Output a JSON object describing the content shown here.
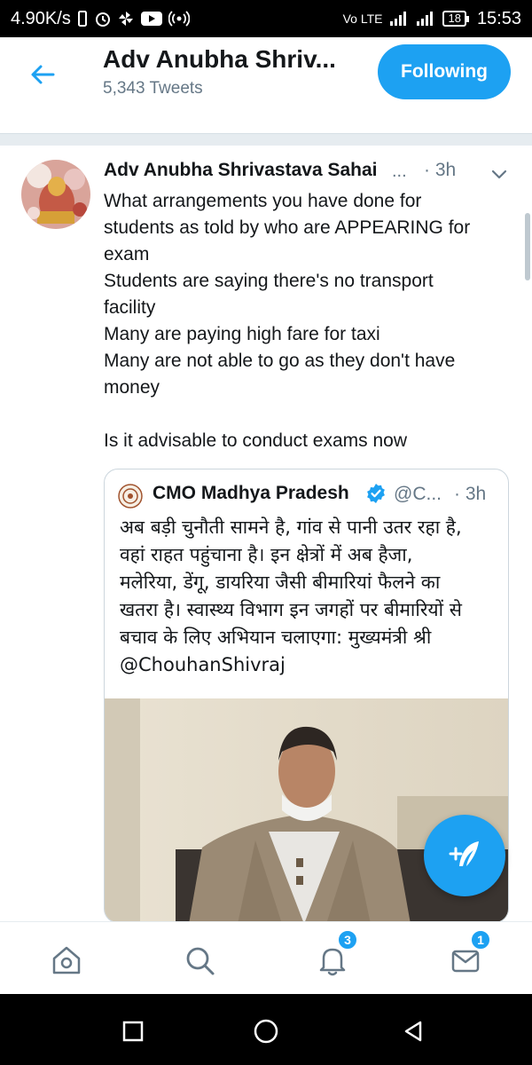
{
  "status_bar": {
    "speed": "4.90K/s",
    "network": "Vo LTE",
    "battery": "18",
    "time": "15:53"
  },
  "header": {
    "title": "Adv Anubha Shriv...",
    "tweet_count": "5,343 Tweets",
    "follow_label": "Following"
  },
  "tweet": {
    "author": "Adv Anubha Shrivastava Sahai",
    "ellipsis": "...",
    "time": "· 3h",
    "lines": [
      "What arrangements you have done for",
      "students as told by who are APPEARING for",
      "exam",
      "Students are saying there's no transport",
      "facility",
      "Many are paying high fare for taxi",
      "Many are not able to go as they don't have",
      "money",
      "Is it advisable to conduct exams now"
    ],
    "quote": {
      "author": "CMO Madhya Pradesh",
      "handle": "@C...",
      "time": "· 3h",
      "lines": [
        "अब बड़ी चुनौती सामने है, गांव से पानी उतर रहा है,",
        "वहां राहत पहुंचाना है। इन क्षेत्रों में अब हैजा,",
        "मलेरिया, डेंगू, डायरिया जैसी बीमारियां फैलने का",
        "खतरा है। स्वास्थ्य विभाग इन जगहों पर बीमारियों से",
        "बचाव के लिए अभियान चलाएगा: मुख्यमंत्री श्री",
        "@ChouhanShivraj"
      ]
    }
  },
  "bottom_nav": {
    "notifications_badge": "3",
    "messages_badge": "1"
  },
  "colors": {
    "accent": "#1da1f2",
    "secondary_text": "#657786",
    "divider": "#e6ecf0"
  },
  "icons": [
    "back-arrow-icon",
    "chevron-down-icon",
    "verified-icon",
    "compose-tweet-icon",
    "home-icon",
    "search-icon",
    "notifications-icon",
    "messages-icon"
  ]
}
